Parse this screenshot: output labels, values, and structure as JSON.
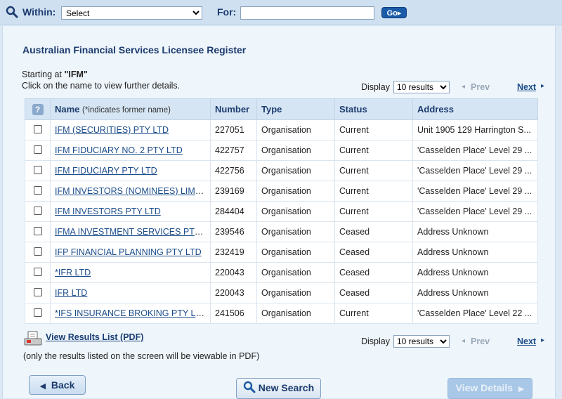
{
  "topbar": {
    "within_label": "Within:",
    "within_value": "Select",
    "for_label": "For:",
    "for_value": "",
    "go_label": "Go"
  },
  "page": {
    "title": "Australian Financial Services Licensee Register",
    "starting_prefix": "Starting at ",
    "starting_value": "\"IFM\"",
    "click_hint": "Click on the name to view further details."
  },
  "pagination": {
    "display_label": "Display",
    "display_value": "10 results",
    "prev_label": "Prev",
    "next_label": "Next"
  },
  "table": {
    "columns": {
      "name": "Name",
      "name_hint": "(*indicates former name)",
      "number": "Number",
      "type": "Type",
      "status": "Status",
      "address": "Address"
    },
    "rows": [
      {
        "name": "IFM (SECURITIES) PTY LTD",
        "number": "227051",
        "type": "Organisation",
        "status": "Current",
        "address": "Unit 1905 129 Harrington S..."
      },
      {
        "name": "IFM FIDUCIARY NO. 2 PTY LTD",
        "number": "422757",
        "type": "Organisation",
        "status": "Current",
        "address": "'Casselden Place' Level 29 ..."
      },
      {
        "name": "IFM FIDUCIARY PTY LTD",
        "number": "422756",
        "type": "Organisation",
        "status": "Current",
        "address": "'Casselden Place' Level 29 ..."
      },
      {
        "name": "IFM INVESTORS (NOMINEES) LIMITED",
        "number": "239169",
        "type": "Organisation",
        "status": "Current",
        "address": "'Casselden Place' Level 29 ..."
      },
      {
        "name": "IFM INVESTORS PTY LTD",
        "number": "284404",
        "type": "Organisation",
        "status": "Current",
        "address": "'Casselden Place' Level 29 ..."
      },
      {
        "name": "IFMA INVESTMENT SERVICES PTY LTD",
        "number": "239546",
        "type": "Organisation",
        "status": "Ceased",
        "address": "Address Unknown"
      },
      {
        "name": "IFP FINANCIAL PLANNING PTY LTD",
        "number": "232419",
        "type": "Organisation",
        "status": "Ceased",
        "address": "Address Unknown"
      },
      {
        "name": "*IFR LTD",
        "number": "220043",
        "type": "Organisation",
        "status": "Ceased",
        "address": "Address Unknown"
      },
      {
        "name": "IFR LTD",
        "number": "220043",
        "type": "Organisation",
        "status": "Ceased",
        "address": "Address Unknown"
      },
      {
        "name": "*IFS INSURANCE BROKING PTY LIMI...",
        "number": "241506",
        "type": "Organisation",
        "status": "Current",
        "address": "'Casselden Place' Level 22 ..."
      }
    ]
  },
  "pdf": {
    "link_label": "View Results List (PDF)",
    "note": "(only the results listed on the screen will be viewable in PDF)"
  },
  "buttons": {
    "back": "Back",
    "new_search": "New Search",
    "view_details": "View Details"
  }
}
